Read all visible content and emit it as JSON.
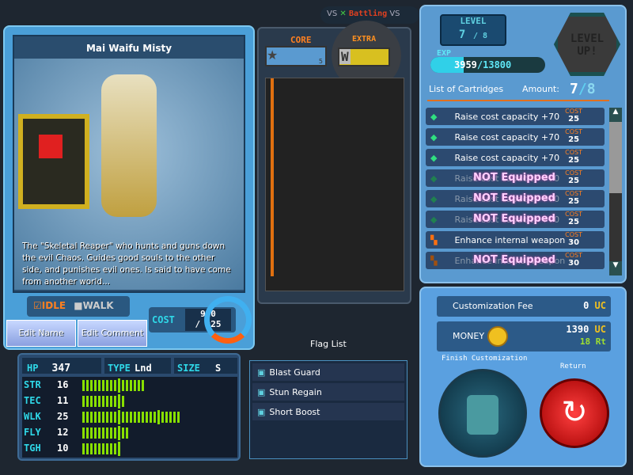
{
  "topbar": {
    "vs1": "VS",
    "status": "Battling",
    "vs2": "VS"
  },
  "robot": {
    "name": "Mai Waifu Misty",
    "description": "The \"Skeletal Reaper\" who hunts and guns down the evil Chaos. Guides good souls to the other side, and punishes evil ones. Is said to have come from another world...",
    "idle_label": "IDLE",
    "walk_label": "WALK",
    "idle_checked": true,
    "walk_checked": false,
    "edit_name": "Edit Name",
    "edit_comment": "Edit Comment",
    "cost_label": "COST",
    "cost_current": "920",
    "cost_max": "/ 925"
  },
  "stats": {
    "hp_label": "HP",
    "hp": "347",
    "type_label": "TYPE",
    "type": "Lnd",
    "size_label": "SIZE",
    "size": "S",
    "rows": [
      {
        "label": "STR",
        "value": 16
      },
      {
        "label": "TEC",
        "value": 11
      },
      {
        "label": "WLK",
        "value": 25
      },
      {
        "label": "FLY",
        "value": 12
      },
      {
        "label": "TGH",
        "value": 10
      }
    ],
    "bar_color": "#88e000"
  },
  "parts": {
    "core_label": "CORE",
    "extra_label": "EXTRA",
    "core_level": "5",
    "extra_icon": "W"
  },
  "flags": {
    "title": "Flag List",
    "items": [
      "Blast Guard",
      "Stun Regain",
      "Short Boost"
    ]
  },
  "level": {
    "label": "LEVEL",
    "current": "7",
    "max": "/ 8",
    "exp_label": "EXP",
    "exp_current": "3959",
    "exp_max": "/13800",
    "exp_fraction": 0.287,
    "level_up": "LEVEL UP!"
  },
  "cartridges": {
    "title": "List of Cartridges",
    "amount_label": "Amount:",
    "amount_current": "7",
    "amount_max": "8",
    "cost_label": "COST",
    "not_equipped": "NOT Equipped",
    "items": [
      {
        "name": "Raise cost capacity +70",
        "cost": "25",
        "equipped": true,
        "icon": "green-cartridge"
      },
      {
        "name": "Raise cost capacity +70",
        "cost": "25",
        "equipped": true,
        "icon": "green-cartridge"
      },
      {
        "name": "Raise cost capacity +70",
        "cost": "25",
        "equipped": true,
        "icon": "green-cartridge"
      },
      {
        "name": "Raise cost capacity +70",
        "cost": "25",
        "equipped": false,
        "icon": "green-cartridge"
      },
      {
        "name": "Raise cost capacity +70",
        "cost": "25",
        "equipped": false,
        "icon": "green-cartridge"
      },
      {
        "name": "Raise cost capacity +70",
        "cost": "25",
        "equipped": false,
        "icon": "green-cartridge"
      },
      {
        "name": "Enhance internal weapon",
        "cost": "30",
        "equipped": true,
        "icon": "orange-gun"
      },
      {
        "name": "Enhance internal weapon",
        "cost": "30",
        "equipped": false,
        "icon": "orange-gun"
      }
    ]
  },
  "shop": {
    "fee_label": "Customization Fee",
    "fee": "0",
    "uc": "UC",
    "money_label": "MONEY",
    "money_uc": "1390",
    "money_rt": "18",
    "rt": "Rt",
    "finish": "Finish Customization",
    "return": "Return"
  }
}
